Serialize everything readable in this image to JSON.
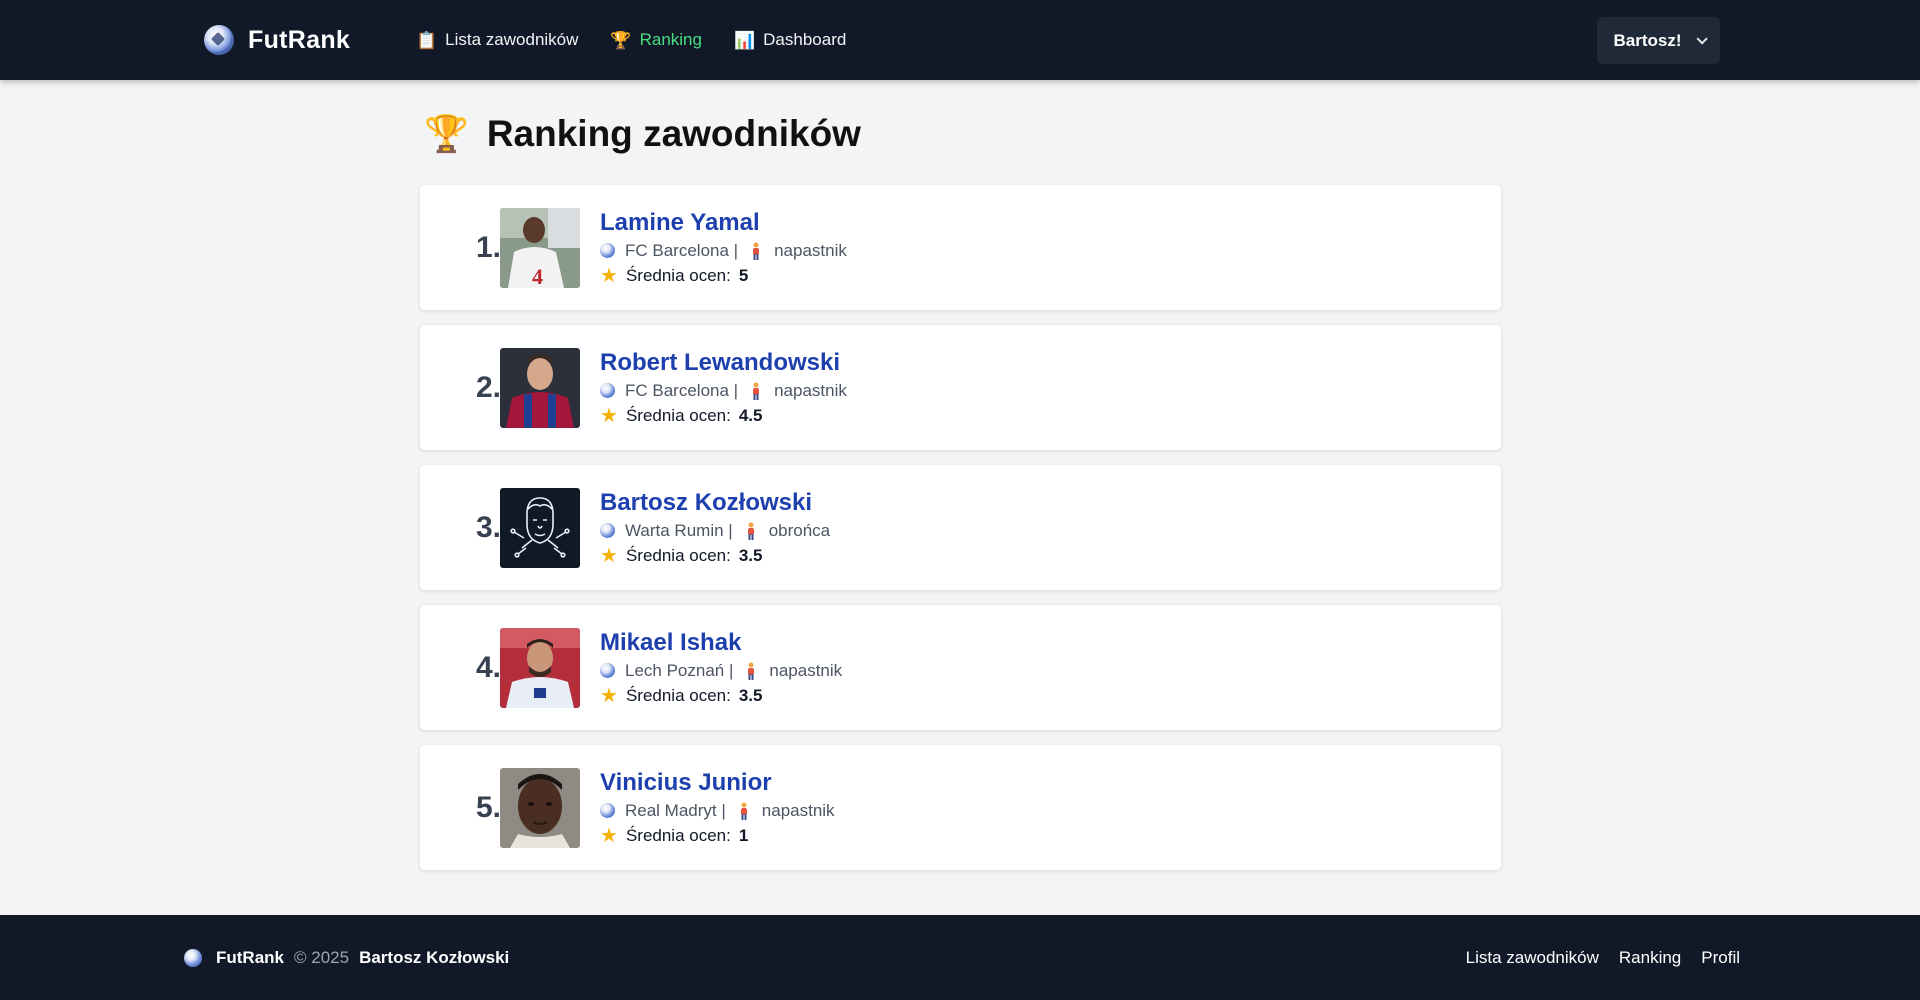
{
  "header": {
    "brand": "FutRank",
    "nav": [
      {
        "label": "Lista zawodników",
        "icon": "clipboard-icon",
        "glyph": "📋"
      },
      {
        "label": "Ranking",
        "icon": "trophy-icon",
        "glyph": "🏆",
        "active": true
      },
      {
        "label": "Dashboard",
        "icon": "bar-chart-icon",
        "glyph": "📊"
      }
    ],
    "user_menu_label": "Bartosz!"
  },
  "main": {
    "title": "Ranking zawodników",
    "title_glyph": "🏆",
    "rating_label": "Średnia ocen:",
    "players": [
      {
        "rank": "1.",
        "name": "Lamine Yamal",
        "club": "FC Barcelona |",
        "position": "napastnik",
        "rating": "5",
        "avatar": "photo"
      },
      {
        "rank": "2.",
        "name": "Robert Lewandowski",
        "club": "FC Barcelona |",
        "position": "napastnik",
        "rating": "4.5",
        "avatar": "photo"
      },
      {
        "rank": "3.",
        "name": "Bartosz Kozłowski",
        "club": "Warta Rumin |",
        "position": "obrońca",
        "rating": "3.5",
        "avatar": "line-art"
      },
      {
        "rank": "4.",
        "name": "Mikael Ishak",
        "club": "Lech Poznań |",
        "position": "napastnik",
        "rating": "3.5",
        "avatar": "photo"
      },
      {
        "rank": "5.",
        "name": "Vinicius Junior",
        "club": "Real Madryt |",
        "position": "napastnik",
        "rating": "1",
        "avatar": "photo"
      }
    ]
  },
  "footer": {
    "brand": "FutRank",
    "copyright": "© 2025",
    "author": "Bartosz Kozłowski",
    "links": [
      "Lista zawodników",
      "Ranking",
      "Profil"
    ]
  },
  "colors": {
    "header_bg": "#111827",
    "active_nav": "#4ade80",
    "player_name": "#1e40af",
    "page_bg": "#f3f4f6"
  }
}
